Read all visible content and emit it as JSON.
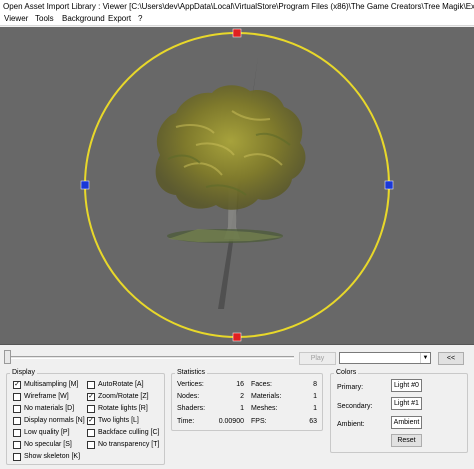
{
  "window": {
    "title": "Open Asset Import Library : Viewer  [C:\\Users\\dev\\AppData\\Local\\VirtualStore\\Program Files (x86)\\The Game Creators\\Tree Magik\\Exports\\billboa"
  },
  "menu": [
    "Viewer",
    "Tools",
    "Background",
    "Export",
    "?"
  ],
  "viewport": {
    "background": "#686868",
    "trackball_color": "#e8d82a",
    "handle_top_bottom_color": "#e02020",
    "handle_left_right_color": "#1a38d8"
  },
  "animation": {
    "play_label": "Play",
    "combo_value": "",
    "prev_label": "<<"
  },
  "display": {
    "title": "Display",
    "options": [
      {
        "label": "Multisampling [M]",
        "checked": true
      },
      {
        "label": "Wireframe [W]",
        "checked": false
      },
      {
        "label": "No materials [D]",
        "checked": false
      },
      {
        "label": "Display normals [N]",
        "checked": false
      },
      {
        "label": "Low quality [P]",
        "checked": false
      },
      {
        "label": "No specular [S]",
        "checked": false
      },
      {
        "label": "Show skeleton [K]",
        "checked": false
      },
      {
        "label": "AutoRotate [A]",
        "checked": false
      },
      {
        "label": "Zoom/Rotate [Z]",
        "checked": true
      },
      {
        "label": "Rotate lights [R]",
        "checked": false
      },
      {
        "label": "Two lights [L]",
        "checked": true
      },
      {
        "label": "Backface culling [C]",
        "checked": false
      },
      {
        "label": "No transparency [T]",
        "checked": false
      }
    ]
  },
  "statistics": {
    "title": "Statistics",
    "vertices_label": "Vertices:",
    "vertices": "16",
    "nodes_label": "Nodes:",
    "nodes": "2",
    "shaders_label": "Shaders:",
    "shaders": "1",
    "time_label": "Time:",
    "time": "0.00900",
    "faces_label": "Faces:",
    "faces": "8",
    "materials_label": "Materials:",
    "materials": "1",
    "meshes_label": "Meshes:",
    "meshes": "1",
    "fps_label": "FPS:",
    "fps": "63"
  },
  "colors": {
    "title": "Colors",
    "primary_label": "Primary:",
    "primary_value": "Light #0",
    "secondary_label": "Secondary:",
    "secondary_value": "Light #1",
    "ambient_label": "Ambient:",
    "ambient_value": "Ambient",
    "reset_label": "Reset"
  }
}
